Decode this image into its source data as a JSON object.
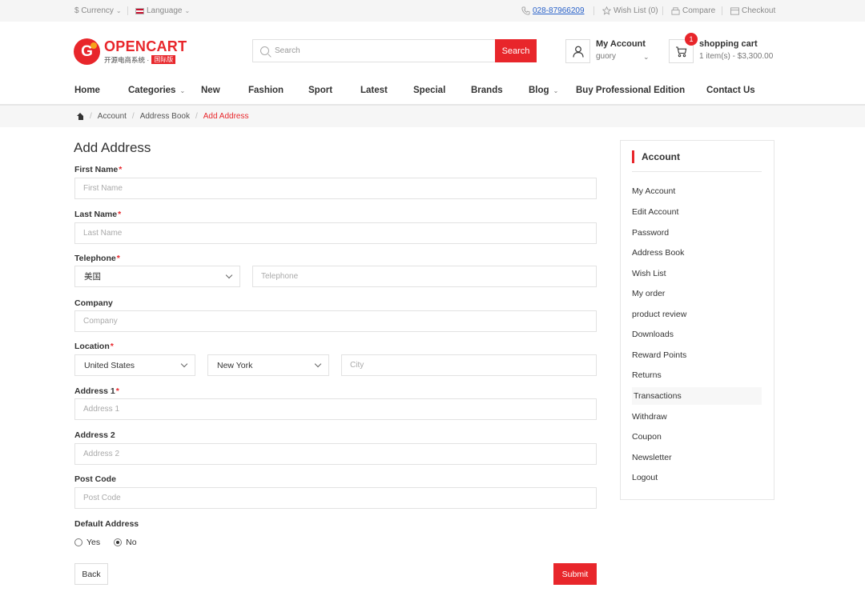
{
  "topbar": {
    "currency_label": "$ Currency",
    "language_label": "Language",
    "phone": "028-87966209",
    "wishlist": "Wish List (0)",
    "compare": "Compare",
    "checkout": "Checkout"
  },
  "brand": {
    "name": "OPENCART",
    "subtitle": "开源电商系统 ·",
    "badge": "国际版"
  },
  "search": {
    "placeholder": "Search",
    "button_label": "Search"
  },
  "account": {
    "title": "My Account",
    "username": "guory"
  },
  "cart": {
    "count": "1",
    "title": "shopping cart",
    "summary": "1 item(s) - $3,300.00"
  },
  "nav": {
    "home": "Home",
    "categories": "Categories",
    "new": "New",
    "fashion": "Fashion",
    "sport": "Sport",
    "latest": "Latest",
    "special": "Special",
    "brands": "Brands",
    "blog": "Blog",
    "buy_pro": "Buy Professional Edition",
    "contact": "Contact Us"
  },
  "breadcrumb": {
    "account": "Account",
    "address_book": "Address Book",
    "current": "Add Address"
  },
  "form": {
    "title": "Add Address",
    "first_name": {
      "label": "First Name",
      "placeholder": "First Name"
    },
    "last_name": {
      "label": "Last Name",
      "placeholder": "Last Name"
    },
    "telephone": {
      "label": "Telephone",
      "country": "美国",
      "placeholder": "Telephone"
    },
    "company": {
      "label": "Company",
      "placeholder": "Company"
    },
    "location": {
      "label": "Location",
      "country": "United States",
      "region": "New York",
      "city_placeholder": "City"
    },
    "address1": {
      "label": "Address 1",
      "placeholder": "Address 1"
    },
    "address2": {
      "label": "Address 2",
      "placeholder": "Address 2"
    },
    "postcode": {
      "label": "Post Code",
      "placeholder": "Post Code"
    },
    "default_address": {
      "label": "Default Address",
      "yes": "Yes",
      "no": "No",
      "selected": "No"
    },
    "required_mark": "*",
    "back_label": "Back",
    "submit_label": "Submit"
  },
  "sidebar": {
    "heading": "Account",
    "links": [
      "My Account",
      "Edit Account",
      "Password",
      "Address Book",
      "Wish List",
      "My order",
      "product review",
      "Downloads",
      "Reward Points",
      "Returns",
      "Transactions",
      "Withdraw",
      "Coupon",
      "Newsletter",
      "Logout"
    ]
  },
  "colors": {
    "accent": "#e8262b",
    "link_blue": "#2a62c9"
  }
}
